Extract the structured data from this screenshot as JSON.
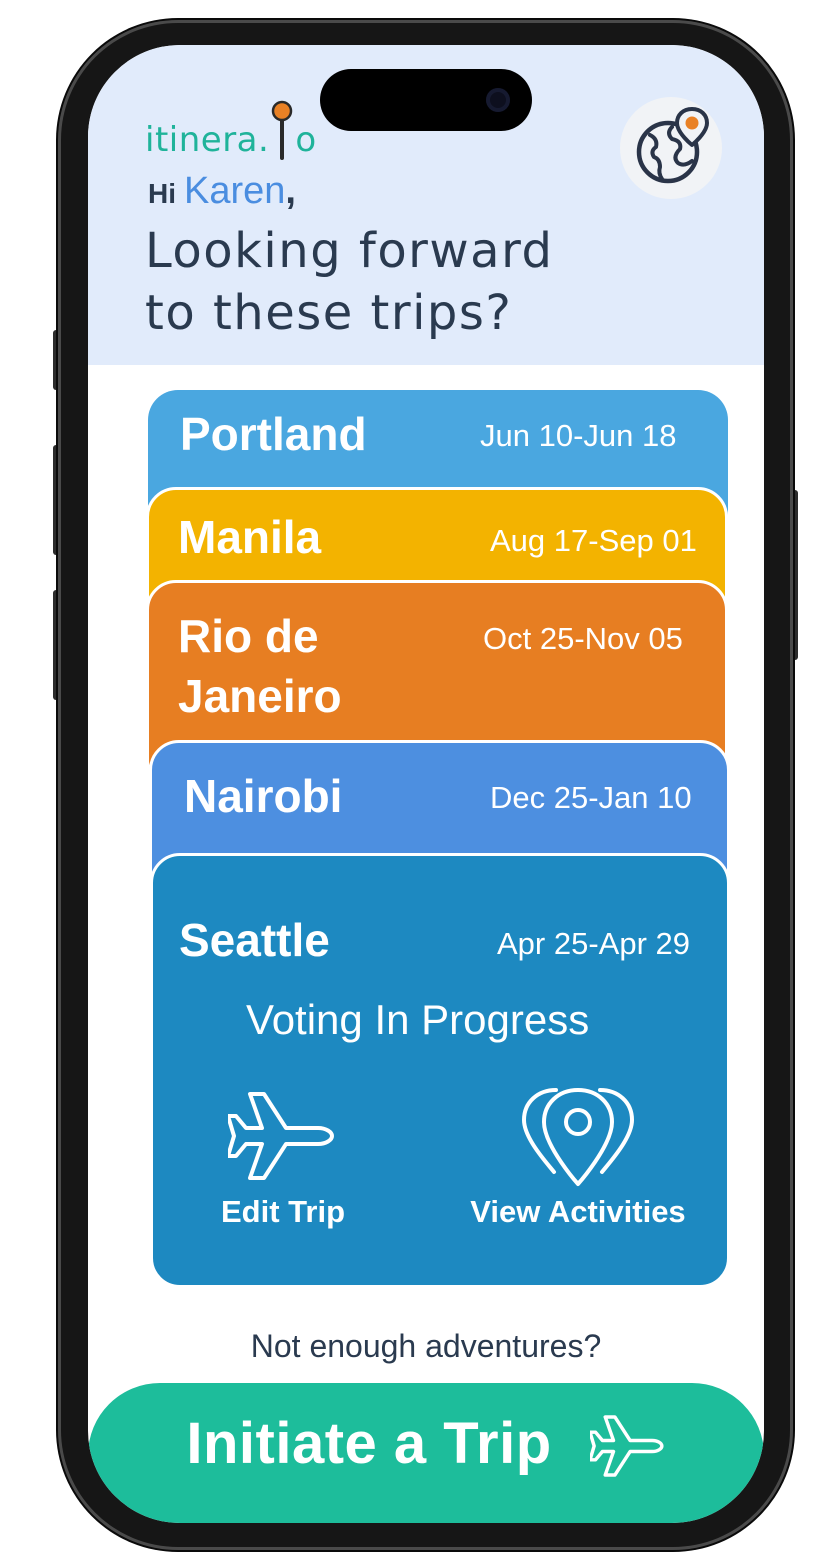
{
  "app": {
    "brand": "itinera.io",
    "brand_left": "itinera.",
    "brand_right": "o"
  },
  "greeting": {
    "hi": "Hi",
    "name": "Karen",
    "comma": ",",
    "headline": "Looking forward\nto these trips?"
  },
  "trips": [
    {
      "city": "Portland",
      "dates": "Jun 10-Jun 18",
      "color": "#4aa7e0"
    },
    {
      "city": "Manila",
      "dates": "Aug 17-Sep 01",
      "color": "#f3b300"
    },
    {
      "city": "Rio de Janeiro",
      "city_line1": "Rio de",
      "city_line2": "Janeiro",
      "dates": "Oct 25-Nov 05",
      "color": "#e77e22"
    },
    {
      "city": "Nairobi",
      "dates": "Dec 25-Jan 10",
      "color": "#4d8fe0"
    },
    {
      "city": "Seattle",
      "dates": "Apr 25-Apr 29",
      "color": "#1d89c1",
      "status": "Voting In Progress",
      "actions": [
        {
          "label": "Edit Trip",
          "icon": "airplane-icon"
        },
        {
          "label": "View Activities",
          "icon": "map-pins-icon"
        }
      ]
    }
  ],
  "footer": {
    "prompt": "Not enough adventures?",
    "cta_label": "Initiate a Trip",
    "cta_icon": "airplane-icon",
    "cta_color": "#1dbd9b"
  },
  "colors": {
    "header_bg": "#e1ebfb",
    "accent_pin": "#e98125",
    "brand_green": "#1fb39a",
    "name_blue": "#4a8de0",
    "text_dark": "#2a3a4f"
  }
}
